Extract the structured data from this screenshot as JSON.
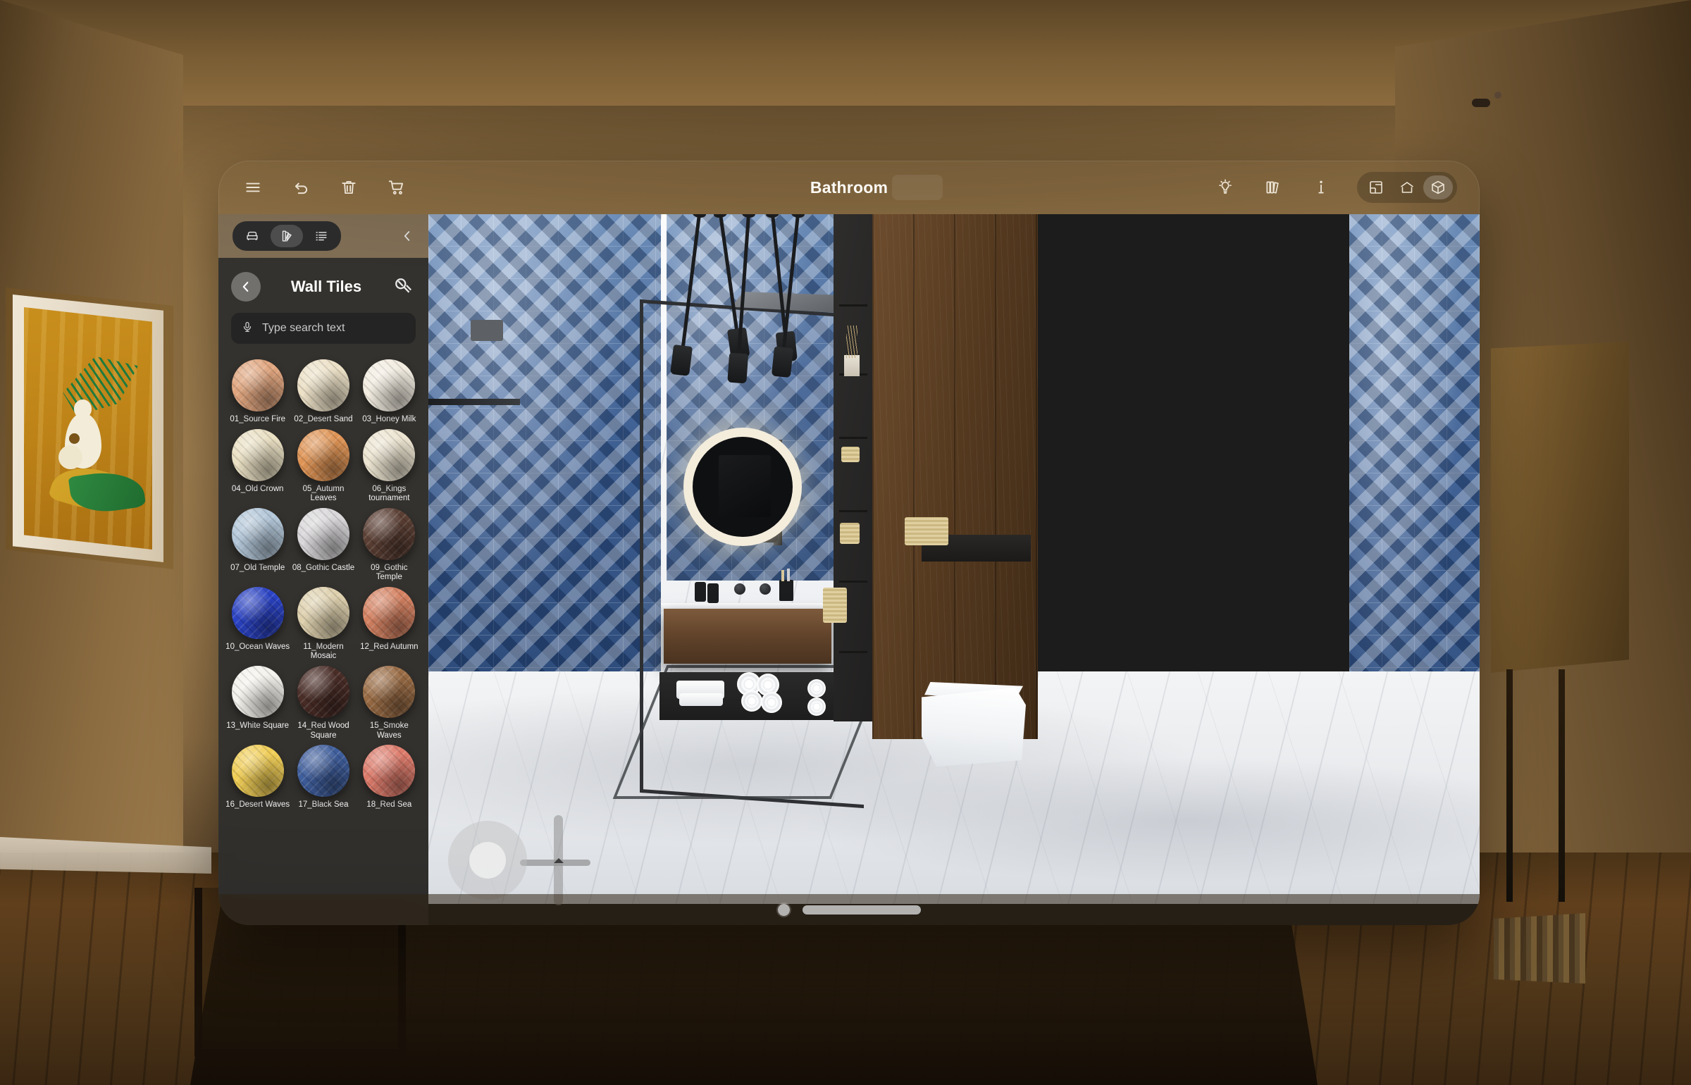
{
  "app": {
    "window_title": "Bathroom"
  },
  "toolbar": {
    "left_items": [
      {
        "name": "menu-icon",
        "label": "Menu"
      },
      {
        "name": "undo-icon",
        "label": "Undo"
      },
      {
        "name": "trash-icon",
        "label": "Delete"
      },
      {
        "name": "cart-icon",
        "label": "Cart"
      }
    ],
    "right_items": [
      {
        "name": "lightbulb-icon",
        "label": "Lighting"
      },
      {
        "name": "books-icon",
        "label": "Library"
      },
      {
        "name": "info-icon",
        "label": "Info"
      }
    ],
    "view_modes": [
      {
        "name": "floorplan-icon",
        "label": "Floor plan",
        "active": false
      },
      {
        "name": "house-icon",
        "label": "2D view",
        "active": false
      },
      {
        "name": "cube-icon",
        "label": "3D view",
        "active": true
      }
    ]
  },
  "sidebar": {
    "mode_tabs": [
      {
        "name": "furniture-icon",
        "label": "Furniture",
        "active": false
      },
      {
        "name": "swatch-icon",
        "label": "Materials",
        "active": true
      },
      {
        "name": "list-icon",
        "label": "List",
        "active": false
      }
    ],
    "collapse_label": "Collapse panel",
    "back_label": "Back",
    "panel_title": "Wall Tiles",
    "head_action_name": "paint-roller-icon",
    "search": {
      "placeholder": "Type search text",
      "value": "",
      "mic_icon": "microphone-icon"
    },
    "materials": [
      {
        "index": "01",
        "label": "01_Source Fire",
        "color": "#e0a57e"
      },
      {
        "index": "02",
        "label": "02_Desert Sand",
        "color": "#ece0c6"
      },
      {
        "index": "03",
        "label": "03_Honey Milk",
        "color": "#f2ece0"
      },
      {
        "index": "04",
        "label": "04_Old Crown",
        "color": "#e9dfc2"
      },
      {
        "index": "05",
        "label": "05_Autumn Leaves",
        "color": "#df9455"
      },
      {
        "index": "06",
        "label": "06_Kings tournament",
        "color": "#ece4d0"
      },
      {
        "index": "07",
        "label": "07_Old Temple",
        "color": "#b2c6d8"
      },
      {
        "index": "08",
        "label": "08_Gothic Castle",
        "color": "#d9d7d9"
      },
      {
        "index": "09",
        "label": "09_Gothic Temple",
        "color": "#5b3f34"
      },
      {
        "index": "10",
        "label": "10_Ocean Waves",
        "color": "#2b43c4"
      },
      {
        "index": "11",
        "label": "11_Modern Mosaic",
        "color": "#ded0ad"
      },
      {
        "index": "12",
        "label": "12_Red Autumn",
        "color": "#d58262"
      },
      {
        "index": "13",
        "label": "13_White Square",
        "color": "#f4f2ec"
      },
      {
        "index": "14",
        "label": "14_Red Wood Square",
        "color": "#4a2d27"
      },
      {
        "index": "15",
        "label": "15_Smoke Waves",
        "color": "#9a6c45"
      },
      {
        "index": "16",
        "label": "16_Desert Waves",
        "color": "#f0cd55"
      },
      {
        "index": "17",
        "label": "17_Black Sea",
        "color": "#3f5e9c"
      },
      {
        "index": "18",
        "label": "18_Red Sea",
        "color": "#dd7b6b"
      }
    ]
  },
  "viewport": {
    "nav_pad_label": "Pan camera",
    "nav_slider_label": "Height slider",
    "scene_name": "Bathroom 3D view"
  },
  "window_footer": {
    "dot_label": "Window control",
    "bar_label": "Window resize handle"
  }
}
